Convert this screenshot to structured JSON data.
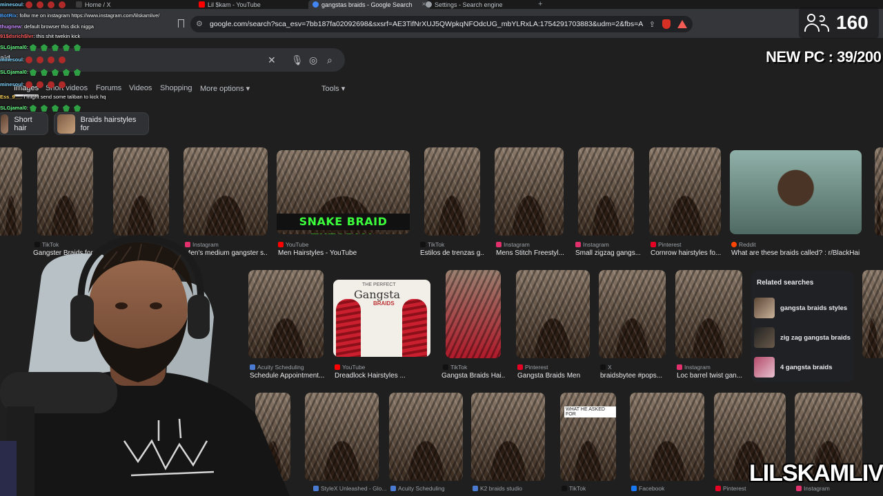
{
  "tabs": [
    {
      "label": "Home / X",
      "color": "#3c3c3c"
    },
    {
      "label": "Lil $kam - YouTube",
      "color": "#ff0000"
    },
    {
      "label": "gangstas braids - Google Search",
      "color": "#4285f4",
      "active": true
    },
    {
      "label": "Settings - Search engine",
      "color": "#9aa0a6"
    }
  ],
  "close_glyph": "×",
  "new_tab_glyph": "+",
  "address": {
    "url": "google.com/search?sca_esv=7bb187fa02092698&sxsrf=AE3TifNrXUJ5QWpkqNFOdcUG_mbYLRxLA:1754291703883&udm=2&fbs=AIljpHxU7SXXni..."
  },
  "search": {
    "query": "aid"
  },
  "nav": {
    "images": "Images",
    "short_videos": "Short videos",
    "forums": "Forums",
    "videos": "Videos",
    "shopping": "Shopping",
    "more": "More options",
    "tools": "Tools"
  },
  "chips": [
    {
      "label": "Short hair"
    },
    {
      "label": "Braids hairstyles for"
    }
  ],
  "row1": [
    {
      "source": "TikTok",
      "title": "Gangster Braids for...",
      "src_color": "#111"
    },
    {
      "source": "Instagram",
      "title": "Men's medium gangster s...",
      "src_color": "#e1306c"
    },
    {
      "source": "YouTube",
      "title": "Men Hairstyles - YouTube",
      "src_color": "#ff0000"
    },
    {
      "source": "TikTok",
      "title": "Estilos de trenzas g...",
      "src_color": "#111"
    },
    {
      "source": "Instagram",
      "title": "Mens Stitch Freestyl...",
      "src_color": "#e1306c"
    },
    {
      "source": "Instagram",
      "title": "Small zigzag gangs...",
      "src_color": "#e1306c"
    },
    {
      "source": "Pinterest",
      "title": "Cornrow hairstyles fo...",
      "src_color": "#e60023"
    },
    {
      "source": "Reddit",
      "title": "What are these braids called? : r/BlackHair",
      "src_color": "#ff4500"
    }
  ],
  "row2": [
    {
      "source": "Acuity Scheduling",
      "title": "Schedule Appointment...",
      "src_color": "#4a7bd0"
    },
    {
      "source": "YouTube",
      "title": "Dreadlock Hairstyles ...",
      "src_color": "#ff0000"
    },
    {
      "source": "TikTok",
      "title": "Gangsta Braids Hai...",
      "src_color": "#111"
    },
    {
      "source": "Pinterest",
      "title": "Gangsta Braids Men",
      "src_color": "#e60023"
    },
    {
      "source": "X",
      "title": "braidsbytee #pops...",
      "src_color": "#111"
    },
    {
      "source": "Instagram",
      "title": "Loc barrel twist gan...",
      "src_color": "#e1306c"
    }
  ],
  "row3": [
    {
      "source": "StyleX Unleashed - Glo...",
      "src_color": "#4a7bd0"
    },
    {
      "source": "Acuity Scheduling",
      "src_color": "#4a7bd0"
    },
    {
      "source": "K2 braids studio",
      "src_color": "#4a7bd0"
    },
    {
      "source": "TikTok",
      "src_color": "#111"
    },
    {
      "source": "Facebook",
      "src_color": "#1877f2"
    },
    {
      "source": "Pinterest",
      "src_color": "#e60023"
    },
    {
      "source": "Instagram",
      "src_color": "#e1306c"
    }
  ],
  "overlays_on_images": {
    "tutorial": "SNAKE BRAID TUTORIAL",
    "perfect_top": "THE PERFECT",
    "perfect_title": "Gangsta",
    "perfect_sub": "BRAIDS",
    "what_he_asked": "WHAT HE ASKED FOR"
  },
  "related": {
    "title": "Related searches",
    "items": [
      "gangsta braids styles",
      "zig zag gangsta braids",
      "4 gangsta braids"
    ]
  },
  "chat": [
    {
      "user": "minesoul",
      "color": "#7fd4ff",
      "text": ":",
      "emotes": [
        "red",
        "red",
        "red",
        "red",
        "red"
      ]
    },
    {
      "user": "BotRix",
      "color": "#4aa3ff",
      "text": ": follw me on instagram https://www.instagram.com/lilskamlive/"
    },
    {
      "user": "thugnew",
      "color": "#c78bff",
      "text": ": default browser this dick nigga"
    },
    {
      "user": "91$dsrich$lvr",
      "color": "#ff5a5a",
      "text": ": this shit twekin kick"
    },
    {
      "user": "SLGjamal0",
      "color": "#6bff8a",
      "text": ":",
      "emotes": [
        "green",
        "green",
        "green",
        "green",
        "green"
      ]
    },
    {
      "user": "minesoul",
      "color": "#7fd4ff",
      "text": ":",
      "emotes": [
        "red",
        "red",
        "red",
        "red",
        "red"
      ]
    },
    {
      "user": "SLGjamal0",
      "color": "#6bff8a",
      "text": ":",
      "emotes": [
        "green",
        "green",
        "green",
        "green",
        "green"
      ]
    },
    {
      "user": "minesoul",
      "color": "#7fd4ff",
      "text": ":",
      "emotes": [
        "red",
        "red",
        "red",
        "red"
      ]
    },
    {
      "user": "Ess_9__",
      "color": "#ffd35a",
      "text": ": I might send some taliban to kick hq"
    },
    {
      "user": "SLGjamal0",
      "color": "#6bff8a",
      "text": ":",
      "emotes": [
        "green",
        "green",
        "green",
        "green",
        "green"
      ]
    }
  ],
  "stream": {
    "viewers": "160",
    "goal": "NEW PC : 39/200",
    "watermark": "LILSKAMLIVE"
  },
  "colors": {
    "page_bg": "#1f1f1f",
    "chrome_bg": "#35363a",
    "text": "#e8eaed",
    "muted": "#9aa0a6"
  }
}
